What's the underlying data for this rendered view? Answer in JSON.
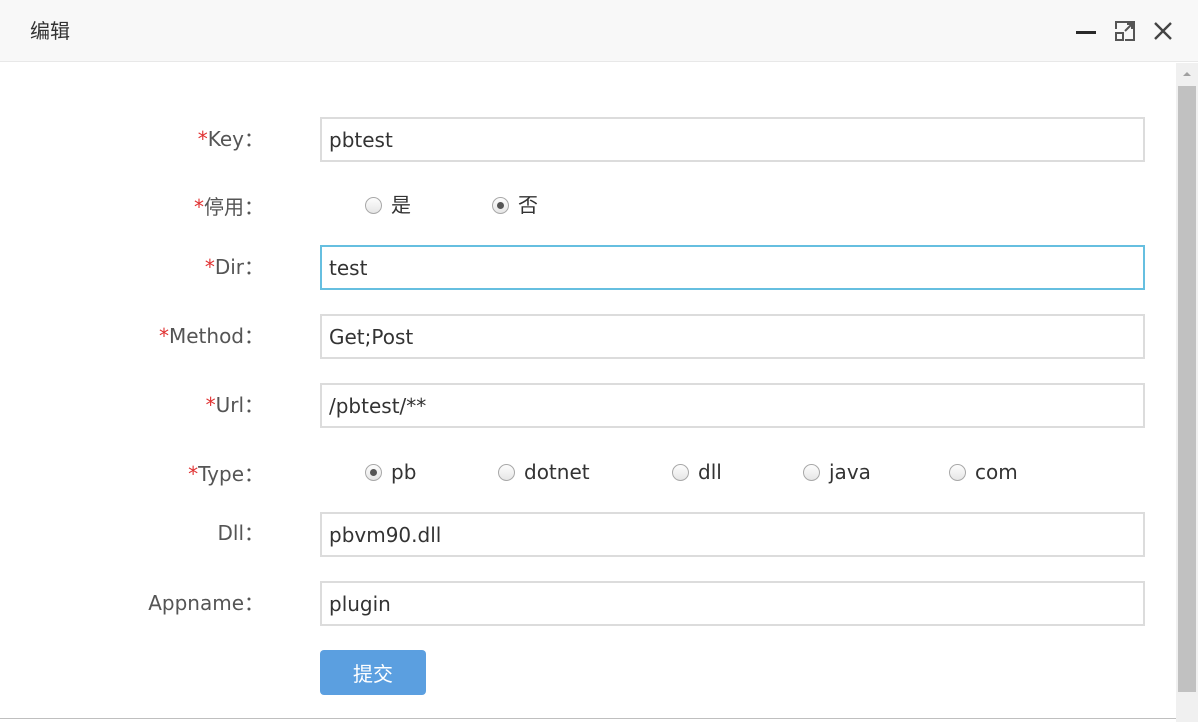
{
  "dialog": {
    "title": "编辑"
  },
  "form": {
    "key": {
      "required_mark": "*",
      "label": "Key：",
      "value": "pbtest"
    },
    "disabled": {
      "required_mark": "*",
      "label": "停用：",
      "options": [
        {
          "label": "是",
          "checked": false
        },
        {
          "label": "否",
          "checked": true
        }
      ]
    },
    "dir": {
      "required_mark": "*",
      "label": "Dir：",
      "value": "test"
    },
    "method": {
      "required_mark": "*",
      "label": "Method：",
      "value": "Get;Post"
    },
    "url": {
      "required_mark": "*",
      "label": "Url：",
      "value": "/pbtest/**"
    },
    "type": {
      "required_mark": "*",
      "label": "Type：",
      "options": [
        {
          "label": "pb",
          "checked": true
        },
        {
          "label": "dotnet",
          "checked": false
        },
        {
          "label": "dll",
          "checked": false
        },
        {
          "label": "java",
          "checked": false
        },
        {
          "label": "com",
          "checked": false
        }
      ]
    },
    "dll": {
      "label": "Dll：",
      "value": "pbvm90.dll"
    },
    "appname": {
      "label": "Appname：",
      "value": "plugin"
    },
    "submit_label": "提交"
  },
  "icons": {
    "minimize": "minimize-icon",
    "maximize": "maximize-icon",
    "close": "close-icon"
  },
  "colors": {
    "required": "#e03131",
    "focus_border": "#66bfe0",
    "submit_bg": "#5b9fe0"
  }
}
